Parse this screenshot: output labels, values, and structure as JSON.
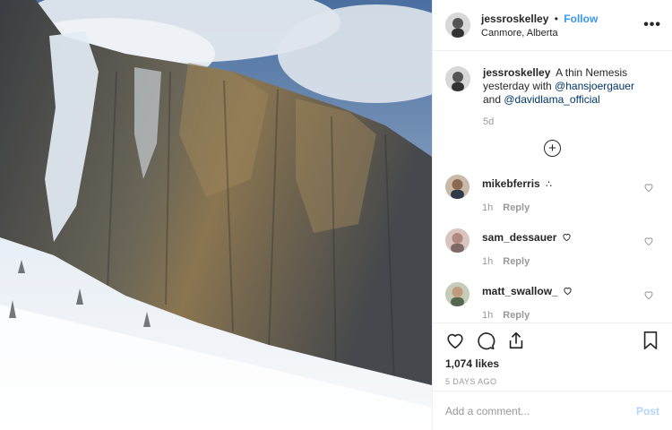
{
  "post": {
    "author": "jessroskelley",
    "follow_label": "Follow",
    "separator": "•",
    "location": "Canmore, Alberta",
    "more_label": "•••",
    "caption": {
      "text_before": "A thin Nemesis yesterday with ",
      "mention1": "@hansjoergauer",
      "text_middle": " and ",
      "mention2": "@davidlama_official",
      "time": "5d"
    },
    "comments": [
      {
        "user": "mikebferris",
        "emoji": "pray-hands",
        "time": "1h",
        "reply": "Reply"
      },
      {
        "user": "sam_dessauer",
        "emoji": "heart",
        "time": "1h",
        "reply": "Reply"
      },
      {
        "user": "matt_swallow_",
        "emoji": "heart",
        "time": "1h",
        "reply": "Reply"
      }
    ],
    "likes": "1,074 likes",
    "posted_ago": "5 DAYS AGO",
    "add_comment_placeholder": "Add a comment...",
    "post_label": "Post"
  },
  "colors": {
    "link": "#3897f0",
    "mention": "#003569",
    "muted": "#999999",
    "post_disabled": "#b3d4fc"
  },
  "icons": [
    "more-options-icon",
    "load-more-comments-icon",
    "heart-icon",
    "comment-icon",
    "share-icon",
    "bookmark-icon"
  ]
}
